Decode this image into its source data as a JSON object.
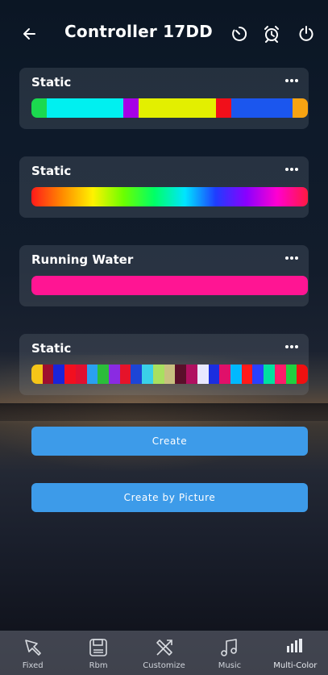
{
  "header": {
    "title": "Controller 17DD",
    "icons": [
      "back-arrow-icon",
      "timer-icon",
      "alarm-clock-icon",
      "power-icon"
    ]
  },
  "cards": [
    {
      "title": "Static",
      "colors": [
        "#1bd94f",
        "#00f0f0",
        "#00f0f0",
        "#00f0f0",
        "#00f0f0",
        "#00f0f0",
        "#a600e6",
        "#e3ef00",
        "#e3ef00",
        "#e3ef00",
        "#e3ef00",
        "#e3ef00",
        "#f10f1a",
        "#1b56ee",
        "#1b56ee",
        "#1b56ee",
        "#1b56ee",
        "#f7a312"
      ],
      "gradient": false
    },
    {
      "title": "Static",
      "colors": [
        "#ff1a1a",
        "#ff8a00",
        "#fff200",
        "#6bff00",
        "#00ff66",
        "#00e5ff",
        "#1f3dff",
        "#8a00ff",
        "#ff00d0",
        "#ff1a40"
      ],
      "gradient": true
    },
    {
      "title": "Running Water",
      "colors": [
        "#ff1593"
      ],
      "gradient": false
    },
    {
      "title": "Static",
      "colors": [
        "#f5c518",
        "#9e0f2e",
        "#1a24d9",
        "#f20f1f",
        "#e01030",
        "#2aa0f0",
        "#2bbd3a",
        "#8a2be2",
        "#e6132a",
        "#1d45d6",
        "#3ad0e8",
        "#a8e060",
        "#c8c080",
        "#5a0f2a",
        "#b01060",
        "#e8e8ff",
        "#1b2ee0",
        "#e0106a",
        "#00b8ff",
        "#ff1a1a",
        "#2a40ff",
        "#00e0a0",
        "#ff1a6a",
        "#20d040",
        "#f01010"
      ],
      "gradient": false
    }
  ],
  "buttons": {
    "create": "Create",
    "create_by_picture": "Create by Picture"
  },
  "nav": [
    {
      "label": "Fixed",
      "icon": "pin-icon"
    },
    {
      "label": "Rbm",
      "icon": "save-icon"
    },
    {
      "label": "Customize",
      "icon": "tools-icon"
    },
    {
      "label": "Music",
      "icon": "music-note-icon"
    },
    {
      "label": "Multi-Color",
      "icon": "bars-icon"
    }
  ],
  "colors": {
    "button": "#3d9be9",
    "card": "rgba(150,158,172,0.18)"
  }
}
